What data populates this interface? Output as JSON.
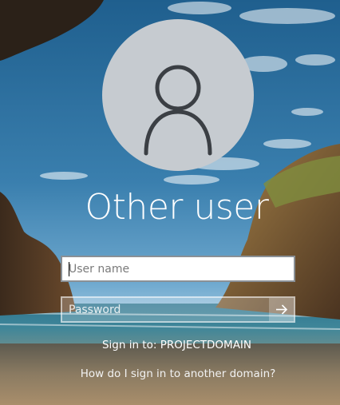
{
  "user": {
    "display_name": "Other user",
    "avatar_icon": "person-outline-icon"
  },
  "form": {
    "username_placeholder": "User name",
    "username_value": "",
    "password_placeholder": "Password",
    "password_value": "",
    "submit_icon": "arrow-right-icon"
  },
  "sign_in_to": "Sign in to: PROJECTDOMAIN",
  "help_link": "How do I sign in to another domain?",
  "colors": {
    "avatar_bg": "#c6cbd0",
    "avatar_glyph": "#3b3f44",
    "text": "#ffffff"
  }
}
